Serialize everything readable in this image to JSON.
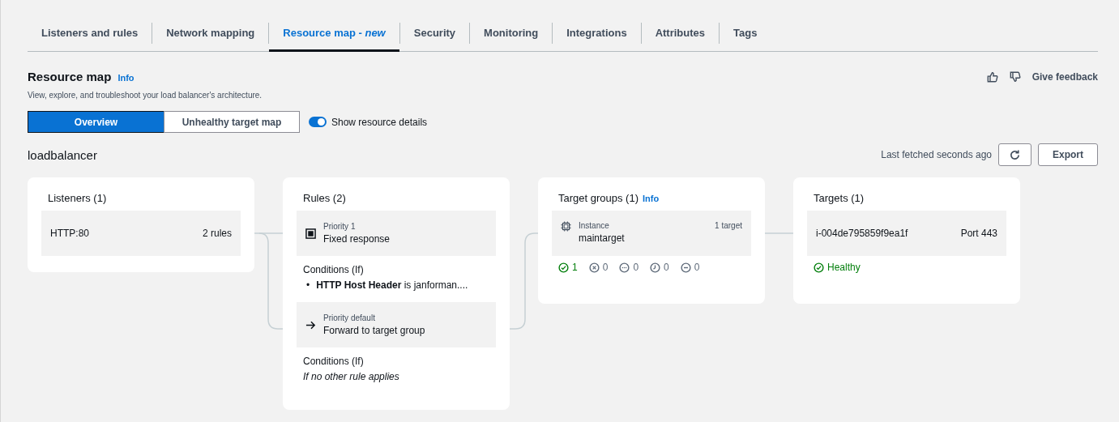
{
  "tabs": [
    {
      "label": "Listeners and rules",
      "selected": false
    },
    {
      "label": "Network mapping",
      "selected": false
    },
    {
      "label": "Resource map - *new*",
      "selected": true
    },
    {
      "label": "Security",
      "selected": false
    },
    {
      "label": "Monitoring",
      "selected": false
    },
    {
      "label": "Integrations",
      "selected": false
    },
    {
      "label": "Attributes",
      "selected": false
    },
    {
      "label": "Tags",
      "selected": false
    }
  ],
  "header": {
    "title": "Resource map",
    "info": "Info",
    "description": "View, explore, and troubleshoot your load balancer's architecture.",
    "feedback": "Give feedback"
  },
  "view_toggle": [
    {
      "label": "Overview",
      "selected": true
    },
    {
      "label": "Unhealthy target map",
      "selected": false
    }
  ],
  "show_details": {
    "label": "Show resource details",
    "on": true
  },
  "load_balancer": "loadbalancer",
  "last_fetched": "Last fetched seconds ago",
  "export_button": "Export",
  "listeners": {
    "title": "Listeners (1)",
    "items": [
      {
        "name": "HTTP:80",
        "rules": "2 rules"
      }
    ]
  },
  "rules": {
    "title": "Rules (2)",
    "items": [
      {
        "kind": "fixed",
        "priority": "Priority 1",
        "action": "Fixed response",
        "conditions_label": "Conditions (If)",
        "conditions": [
          {
            "bullet": "•",
            "text": "**HTTP Host Header** is janforman...."
          }
        ]
      },
      {
        "kind": "forward",
        "priority": "Priority default",
        "action": "Forward to target group",
        "conditions_label": "Conditions (If)",
        "note": "If no other rule applies"
      }
    ]
  },
  "target_groups": {
    "title": "Target groups (1)",
    "info": "Info",
    "items": [
      {
        "type": "Instance",
        "name": "maintarget",
        "count": "1 target",
        "statuses": [
          {
            "kind": "healthy",
            "value": "1"
          },
          {
            "kind": "unhealthy",
            "value": "0"
          },
          {
            "kind": "unused",
            "value": "0"
          },
          {
            "kind": "pending",
            "value": "0"
          },
          {
            "kind": "draining",
            "value": "0"
          }
        ]
      }
    ]
  },
  "targets": {
    "title": "Targets (1)",
    "items": [
      {
        "id": "i-004de795859f9ea1f",
        "port": "Port 443",
        "status": "Healthy"
      }
    ]
  }
}
